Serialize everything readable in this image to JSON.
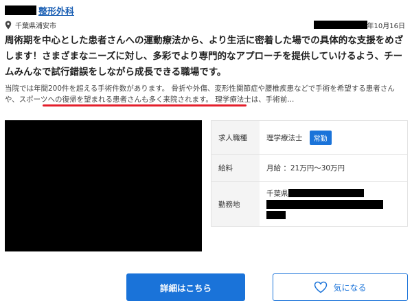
{
  "job": {
    "clinic_name": "整形外科",
    "location": "千葉県浦安市",
    "date_suffix": "年10月16日",
    "headline": "周術期を中心とした患者さんへの運動療法から、より生活に密着した場での具体的な支援をめざします！さまざまなニーズに対し、多彩でより専門的なアプローチを提供していけるよう、チームみんなで試行錯誤をしながら成長できる職場です。",
    "summary_part1": "当院では年間200件を超える手術件数があります。 骨折や外傷、変形性関節症や腰椎疾患などで手術を希望する患者さんや、",
    "summary_highlight": "スポーツへの復帰を望まれる患者さんも多く来院されます。",
    "summary_part2": " 理学療法士は、手術前..."
  },
  "info": {
    "job_type_label": "求人職種",
    "job_type_value": "理学療法士",
    "employment_badge": "常勤",
    "salary_label": "給料",
    "salary_value": "月給 ：21万円〜30万円",
    "workplace_label": "勤務地",
    "workplace_prefix": "千葉県"
  },
  "actions": {
    "detail_label": "詳細はこちら",
    "favorite_label": "気になる"
  },
  "colors": {
    "accent": "#1a73d9",
    "link": "#1a5fb4",
    "annotation": "#e41e2b"
  },
  "icons": {
    "location": "map-pin-icon",
    "favorite": "heart-icon"
  }
}
